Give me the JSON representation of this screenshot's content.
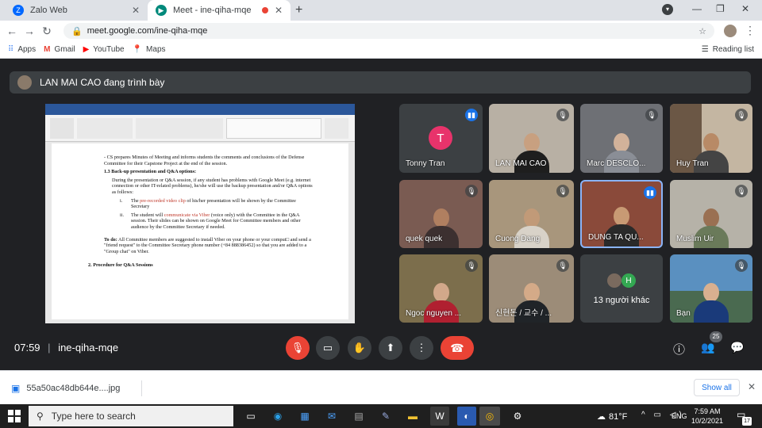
{
  "browser": {
    "tabs": [
      {
        "title": "Zalo Web",
        "active": false
      },
      {
        "title": "Meet - ine-qiha-mqe",
        "active": true
      }
    ],
    "new_tab": "+",
    "url": "meet.google.com/ine-qiha-mqe",
    "bookmarks": [
      "Apps",
      "Gmail",
      "YouTube",
      "Maps"
    ],
    "reading_list": "Reading list"
  },
  "meet": {
    "presenting": "LAN MAI CAO đang trình bày",
    "meeting_time": "07:59",
    "meeting_code": "ine-qiha-mqe",
    "people_count": "25",
    "participants": [
      {
        "name": "Tonny Tran",
        "avatar_letter": "T",
        "speaking": true
      },
      {
        "name": "LAN MAI CAO"
      },
      {
        "name": "Marc DESCLO..."
      },
      {
        "name": "Huy Tran"
      },
      {
        "name": "quek quek"
      },
      {
        "name": "Cuong Dang"
      },
      {
        "name": "DUNG TA QU...",
        "speaking": true
      },
      {
        "name": "Muslim Uir"
      },
      {
        "name": "Ngoc nguyen ..."
      },
      {
        "name": "신현돈 / 교수 / ..."
      },
      {
        "name": "13 người khác",
        "avatar_letter": "H"
      },
      {
        "name": "Bạn"
      }
    ]
  },
  "document": {
    "lines": [
      "- CS prepares Minutes of Meeting and informs students the comments and conclusions of the Defense Committee for their Capstone Project at the end of the session.",
      "1.3 Back-up presentation and Q&A options:",
      "During the presentation or Q&A session, if any student has problems with Google Meet (e.g. internet connection or other IT-related problems), he/she will use the backup presentation and/or Q&A options as follows:",
      "i.",
      "The",
      "pre-recorded video clip",
      "of his/her presentation will be shown by the Committee Secretary",
      "ii.",
      "The student will",
      "communicate via Viber",
      "(voice only) with the Committee in the Q&A session. Their slides can be shown on Google Meet for Committee members and other audience by the Committee Secretary if needed.",
      "To do:",
      "All Committee members are suggested to install Viber on your phone or your comput□ and send a \"friend request\" to the Committee Secretary phone number (+84 888386452) so that you are added to a \"Group chat\" on Viber.",
      "2. Procedure for Q&A Sessions"
    ]
  },
  "download": {
    "file": "55a50ac48db644e....jpg",
    "show_all": "Show all"
  },
  "taskbar": {
    "search_placeholder": "Type here to search",
    "temperature": "81°F",
    "language": "ENG",
    "time": "7:59 AM",
    "date": "10/2/2021",
    "notifications": "17"
  },
  "colors": {
    "meet_bg": "#202124",
    "tile_bg": "#3c4043",
    "red": "#ea4335",
    "blue": "#1a73e8",
    "avatar_pink": "#e8336b",
    "avatar_green": "#33a852"
  }
}
